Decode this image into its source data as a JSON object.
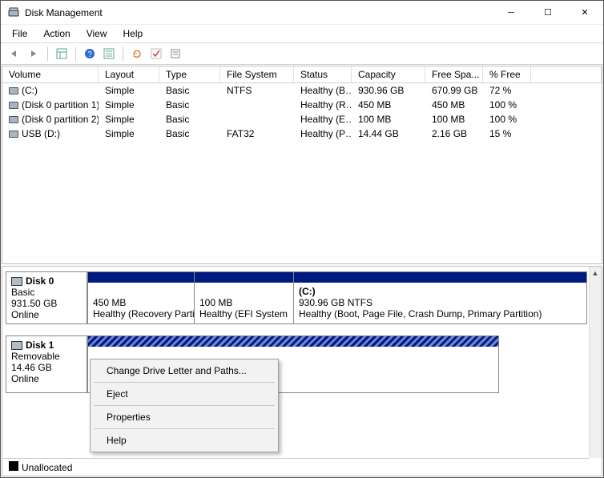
{
  "window": {
    "title": "Disk Management"
  },
  "menus": {
    "file": "File",
    "action": "Action",
    "view": "View",
    "help": "Help"
  },
  "columns": {
    "volume": "Volume",
    "layout": "Layout",
    "type": "Type",
    "fs": "File System",
    "status": "Status",
    "capacity": "Capacity",
    "free": "Free Spa...",
    "pct": "% Free"
  },
  "volumes": [
    {
      "name": "(C:)",
      "layout": "Simple",
      "type": "Basic",
      "fs": "NTFS",
      "status": "Healthy (B…",
      "capacity": "930.96 GB",
      "free": "670.99 GB",
      "pct": "72 %"
    },
    {
      "name": "(Disk 0 partition 1)",
      "layout": "Simple",
      "type": "Basic",
      "fs": "",
      "status": "Healthy (R…",
      "capacity": "450 MB",
      "free": "450 MB",
      "pct": "100 %"
    },
    {
      "name": "(Disk 0 partition 2)",
      "layout": "Simple",
      "type": "Basic",
      "fs": "",
      "status": "Healthy (E…",
      "capacity": "100 MB",
      "free": "100 MB",
      "pct": "100 %"
    },
    {
      "name": "USB (D:)",
      "layout": "Simple",
      "type": "Basic",
      "fs": "FAT32",
      "status": "Healthy (P…",
      "capacity": "14.44 GB",
      "free": "2.16 GB",
      "pct": "15 %"
    }
  ],
  "disks": {
    "d0": {
      "label": "Disk 0",
      "type": "Basic",
      "size": "931.50 GB",
      "state": "Online",
      "p1": {
        "title": "",
        "size": "450 MB",
        "status": "Healthy (Recovery Partition)"
      },
      "p2": {
        "title": "",
        "size": "100 MB",
        "status": "Healthy (EFI System"
      },
      "p3": {
        "title": "(C:)",
        "size": "930.96 GB NTFS",
        "status": "Healthy (Boot, Page File, Crash Dump, Primary Partition)"
      }
    },
    "d1": {
      "label": "Disk 1",
      "type": "Removable",
      "size": "14.46 GB",
      "state": "Online"
    }
  },
  "context_menu": {
    "change": "Change Drive Letter and Paths...",
    "eject": "Eject",
    "properties": "Properties",
    "help": "Help"
  },
  "legend": {
    "unallocated": "Unallocated"
  }
}
